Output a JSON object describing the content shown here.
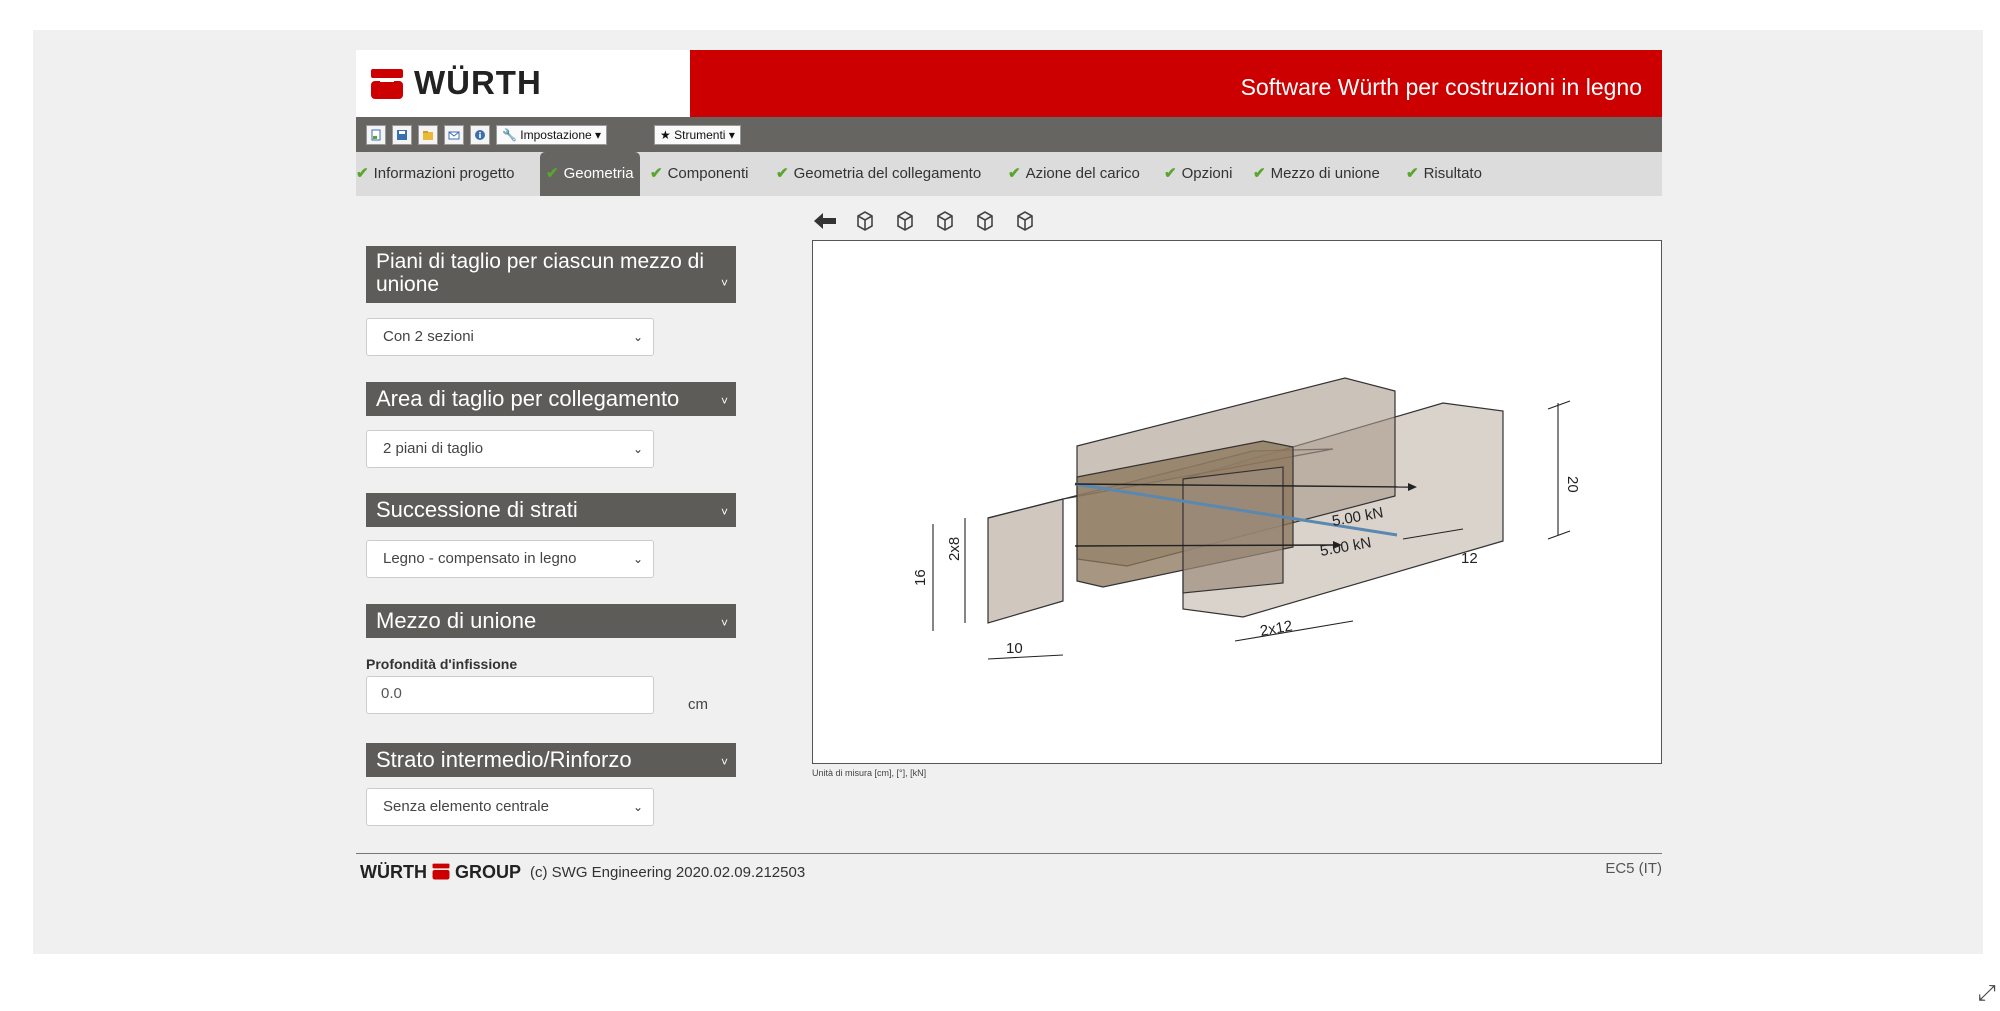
{
  "header": {
    "logo_text": "WÜRTH",
    "app_title": "Software Würth per costruzioni in legno"
  },
  "toolbar": {
    "icons": [
      "new-file-icon",
      "save-icon",
      "open-folder-icon",
      "email-icon",
      "info-icon"
    ],
    "menu_settings": "Impostazione",
    "menu_tools": "Strumenti"
  },
  "steps": [
    {
      "label": "Informazioni progetto"
    },
    {
      "label": "Geometria"
    },
    {
      "label": "Componenti"
    },
    {
      "label": "Geometria del collegamento"
    },
    {
      "label": "Azione del carico"
    },
    {
      "label": "Opzioni"
    },
    {
      "label": "Mezzo di unione"
    },
    {
      "label": "Risultato"
    }
  ],
  "panels": {
    "shear_planes": {
      "title": "Piani di taglio per ciascun mezzo di unione",
      "value": "Con 2 sezioni"
    },
    "shear_area": {
      "title": "Area di taglio per collegamento",
      "value": "2 piani di taglio"
    },
    "layers": {
      "title": "Successione di strati",
      "value": "Legno - compensato in legno"
    },
    "fastener": {
      "title": "Mezzo di unione",
      "depth_label": "Profondità d'infissione",
      "depth_value": "0.0",
      "depth_unit": "cm"
    },
    "intermediate": {
      "title": "Strato intermedio/Rinforzo",
      "value": "Senza elemento centrale"
    }
  },
  "viewer": {
    "units_note": "Unità di misura [cm], [°], [kN]",
    "dims": {
      "d20": "20",
      "d16": "16",
      "d2x8": "2x8",
      "d10": "10",
      "d12": "12",
      "d2x12": "2x12"
    },
    "forces": {
      "f1": "5.00 kN",
      "f2": "5.00 kN"
    }
  },
  "footer": {
    "logo": "WÜRTH",
    "group": "GROUP",
    "copyright": "(c) SWG Engineering 2020.02.09.212503",
    "norm": "EC5 (IT)"
  },
  "colors": {
    "brand_red": "#cc0000",
    "dark_gray": "#5e5c58",
    "check_green": "#5aa530"
  }
}
